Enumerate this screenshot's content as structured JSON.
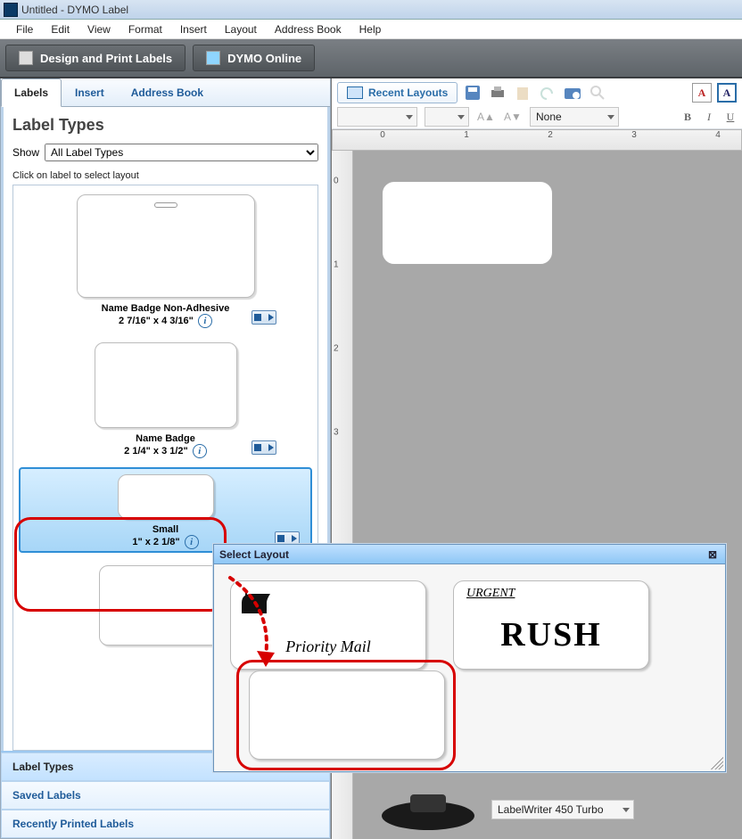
{
  "window": {
    "title": "Untitled - DYMO Label"
  },
  "menu": [
    "File",
    "Edit",
    "View",
    "Format",
    "Insert",
    "Layout",
    "Address Book",
    "Help"
  ],
  "ribbon": {
    "design": "Design and Print Labels",
    "online": "DYMO Online"
  },
  "tabs": {
    "labels": "Labels",
    "insert": "Insert",
    "addressbook": "Address Book"
  },
  "panel": {
    "title": "Label Types",
    "showLabel": "Show",
    "showValue": "All Label Types",
    "hint": "Click on label to select layout",
    "items": [
      {
        "name": "Name Badge Non-Adhesive",
        "size": "2 7/16\" x 4 3/16\""
      },
      {
        "name": "Name Badge",
        "size": "2 1/4\" x 3 1/2\""
      },
      {
        "name": "Small",
        "size": "1\" x 2 1/8\""
      }
    ]
  },
  "accordion": {
    "labelTypes": "Label Types",
    "saved": "Saved Labels",
    "recent": "Recently Printed Labels"
  },
  "toolbar": {
    "recent": "Recent Layouts",
    "effects": "None"
  },
  "biu": {
    "b": "B",
    "i": "I",
    "u": "U"
  },
  "ruler": {
    "h": [
      "0",
      "1",
      "2",
      "3",
      "4"
    ],
    "v": [
      "0",
      "1",
      "2",
      "3"
    ]
  },
  "popup": {
    "title": "Select Layout",
    "priority": "Priority Mail",
    "urgent": "URGENT",
    "rush": "RUSH"
  },
  "printer": {
    "name": "LabelWriter 450 Turbo"
  }
}
